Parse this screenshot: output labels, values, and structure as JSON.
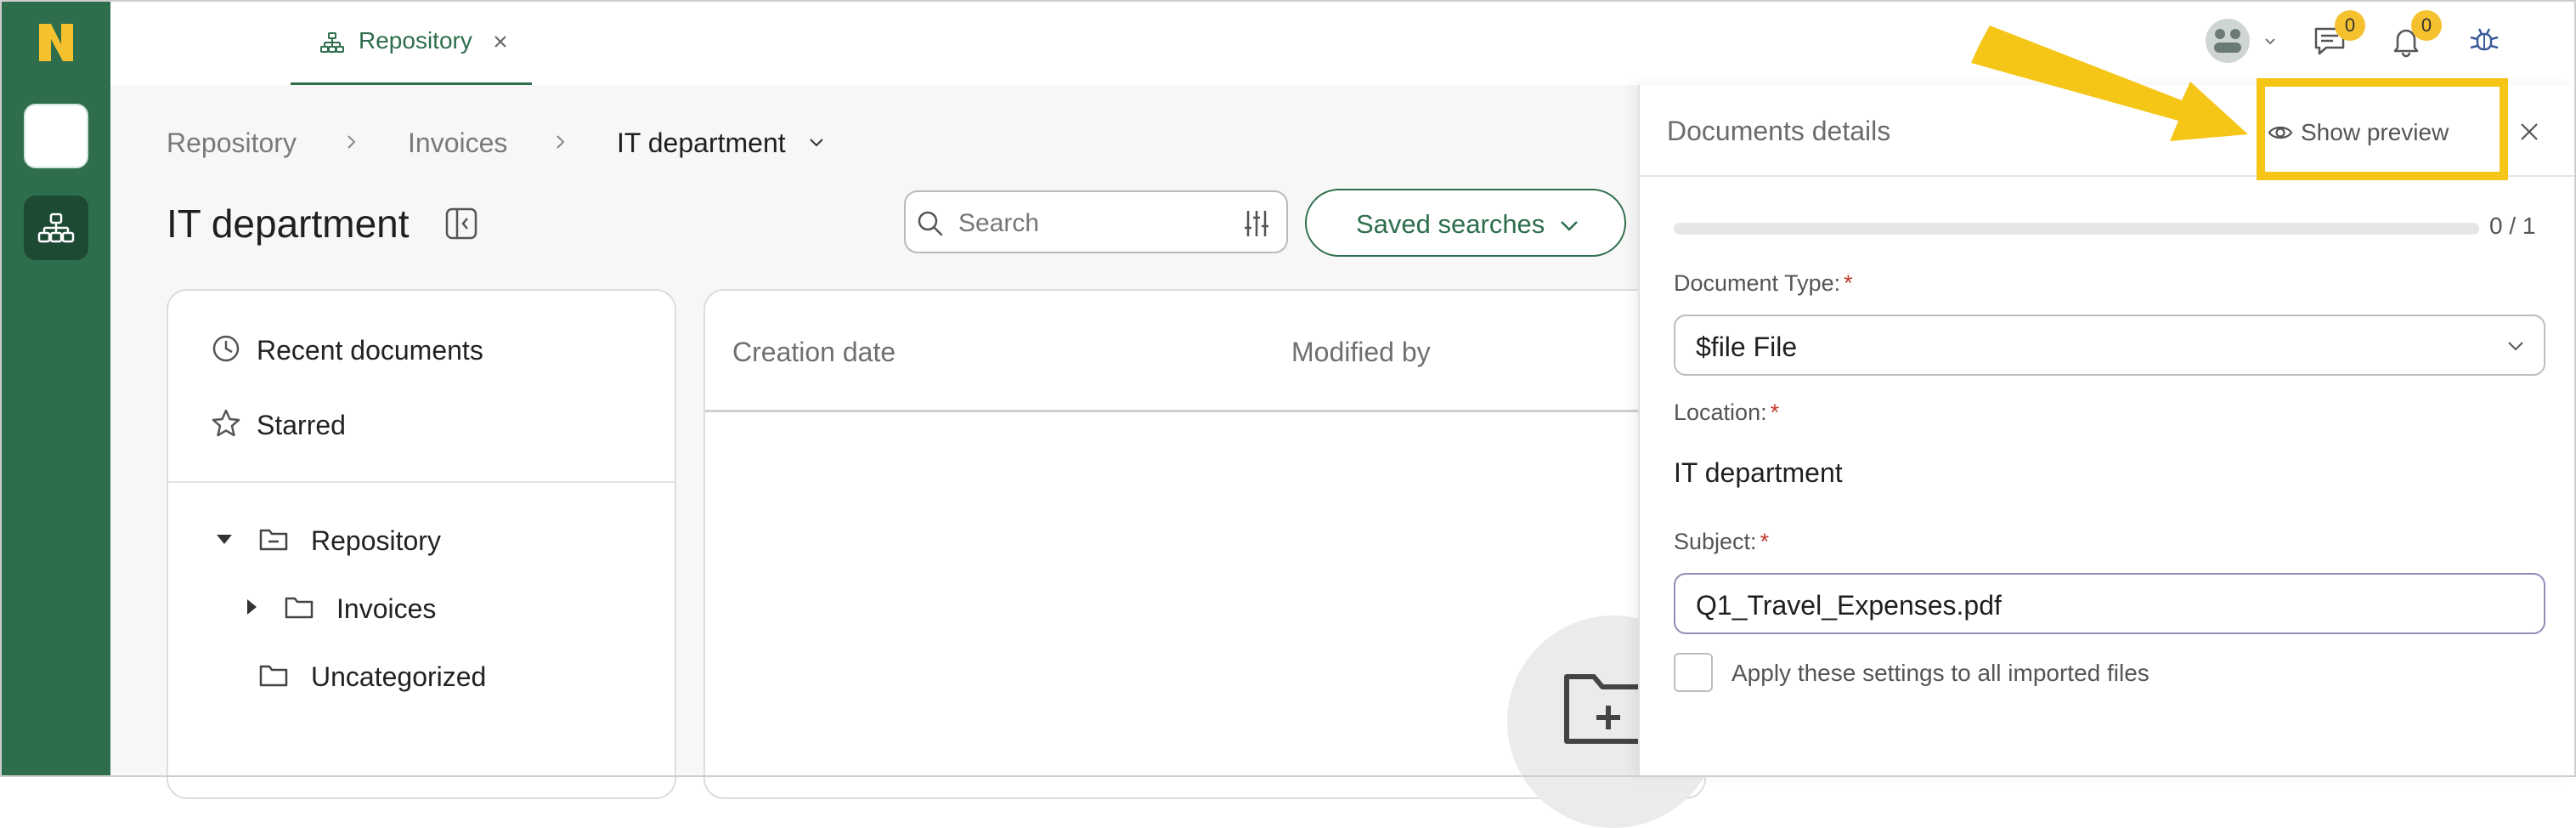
{
  "top_bar": {
    "tab": {
      "label": "Repository"
    },
    "chat_badge": "0",
    "notifications_badge": "0"
  },
  "breadcrumb": {
    "items": [
      "Repository",
      "Invoices",
      "IT department"
    ]
  },
  "page": {
    "title": "IT department"
  },
  "search": {
    "placeholder": "Search"
  },
  "saved_searches": {
    "label": "Saved searches"
  },
  "left_panel": {
    "quick_links": [
      "Recent documents",
      "Starred"
    ],
    "tree": {
      "root": "Repository",
      "children": [
        "Invoices"
      ],
      "other": "Uncategorized"
    }
  },
  "table": {
    "columns": [
      "Creation date",
      "Modified by"
    ]
  },
  "details": {
    "title": "Documents details",
    "show_preview": "Show preview",
    "progress": {
      "text": "0 / 1",
      "fraction": 0
    },
    "document_type": {
      "label": "Document Type:",
      "value": "$file File"
    },
    "location": {
      "label": "Location:",
      "value": "IT department"
    },
    "subject": {
      "label": "Subject:",
      "value": "Q1_Travel_Expenses.pdf"
    },
    "apply_all": {
      "label": "Apply these settings to all imported files"
    },
    "required_mark": "*"
  },
  "colors": {
    "brand_green": "#2e6e4c",
    "logo_yellow": "#f5c12e",
    "highlight_yellow": "#f5c518"
  }
}
